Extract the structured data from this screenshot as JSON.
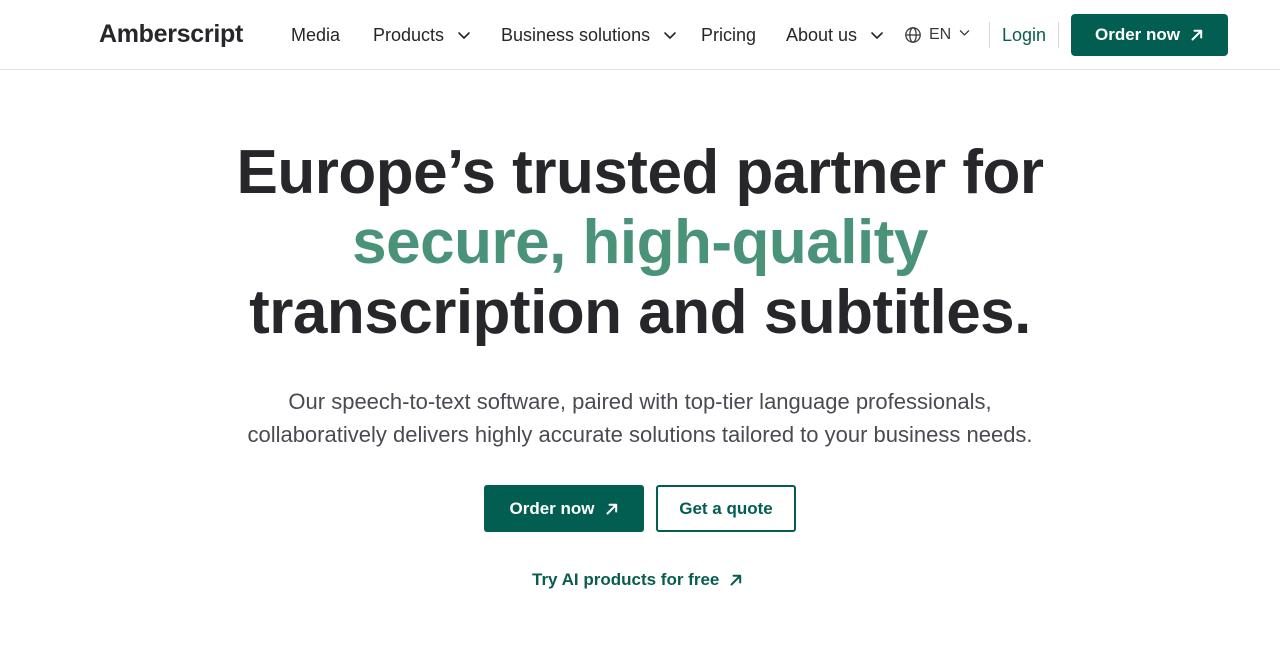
{
  "header": {
    "logo_text": "Amberscript",
    "nav": [
      {
        "label": "Media",
        "has_dropdown": false
      },
      {
        "label": "Products",
        "has_dropdown": true
      },
      {
        "label": "Business solutions",
        "has_dropdown": true
      },
      {
        "label": "Pricing",
        "has_dropdown": false
      },
      {
        "label": "About us",
        "has_dropdown": true
      }
    ],
    "language": "EN",
    "login_label": "Login",
    "order_label": "Order now"
  },
  "hero": {
    "title_line1": "Europe’s trusted partner for",
    "title_accent": "secure, high-quality",
    "title_line3": "transcription and subtitles.",
    "subtitle_line1": "Our speech-to-text software, paired with top-tier language professionals,",
    "subtitle_line2": "collaboratively delivers highly accurate solutions tailored to your business needs.",
    "order_label": "Order now",
    "quote_label": "Get a quote",
    "try_label": "Try AI products for free"
  },
  "colors": {
    "brand": "#035e52",
    "accent": "#4a9378",
    "text": "#26262b"
  },
  "icons": [
    "chevron-down-icon",
    "globe-icon",
    "arrow-up-right-icon"
  ]
}
